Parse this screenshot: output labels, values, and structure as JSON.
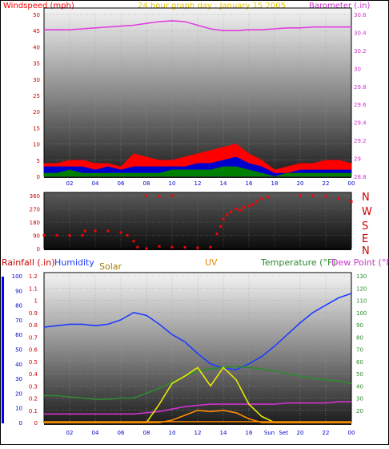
{
  "colors": {
    "windspeed": "#ff0000",
    "wind_avg": "#0000cc",
    "wind_low": "#008000",
    "barometer": "#e040e0",
    "direction": "#ff0000",
    "humidity": "#1e3cff",
    "temperature": "#2e8b2e",
    "dewpoint": "#cc33cc",
    "solar": "#e8e800",
    "uv": "#ff8c00",
    "rainfall": "#0000ff",
    "dew_pink": "#ff3399",
    "title": "#e8c800",
    "frame": "#000000"
  },
  "chart_data": [
    {
      "type": "line",
      "title": "24 hour graph day : January 15 2005",
      "ylabel": "Windspeed (mph)",
      "y2label": "Barometer (.in)",
      "ylim": [
        0,
        50
      ],
      "y2lim": [
        28.8,
        30.6
      ],
      "yticks": [
        "0",
        "5",
        "10",
        "15",
        "20",
        "25",
        "30",
        "35",
        "40",
        "45",
        "50"
      ],
      "y2ticks": [
        "28.8",
        "29",
        "29.2",
        "29.4",
        "29.6",
        "29.8",
        "30",
        "30.2",
        "30.4",
        "30.6"
      ],
      "xticks": [
        "02",
        "04",
        "06",
        "08",
        "10",
        "12",
        "14",
        "16",
        "18",
        "20",
        "22",
        "00"
      ],
      "x": [
        0,
        1,
        2,
        3,
        4,
        5,
        6,
        7,
        8,
        9,
        10,
        11,
        12,
        13,
        14,
        15,
        16,
        17,
        18,
        19,
        20,
        21,
        22,
        23,
        24
      ],
      "series": [
        {
          "key": "barometer",
          "axis": "right",
          "values": [
            30.43,
            30.43,
            30.43,
            30.44,
            30.45,
            30.46,
            30.47,
            30.48,
            30.5,
            30.52,
            30.53,
            30.52,
            30.48,
            30.44,
            30.42,
            30.42,
            30.43,
            30.43,
            30.44,
            30.45,
            30.45,
            30.46,
            30.46,
            30.46,
            30.46
          ]
        },
        {
          "key": "wind_high",
          "axis": "left",
          "values": [
            4,
            4,
            5,
            5,
            4,
            4,
            3,
            7,
            6,
            5,
            5,
            6,
            7,
            8,
            9,
            10,
            7,
            5,
            2,
            3,
            4,
            4,
            5,
            5,
            4
          ]
        },
        {
          "key": "wind_avg",
          "axis": "left",
          "values": [
            3,
            3,
            3,
            3,
            2,
            3,
            2,
            3,
            3,
            3,
            3,
            3,
            4,
            4,
            5,
            6,
            4,
            3,
            1,
            1,
            2,
            2,
            2,
            2,
            2
          ]
        },
        {
          "key": "wind_low",
          "axis": "left",
          "values": [
            1,
            1,
            2,
            1,
            1,
            1,
            1,
            1,
            1,
            1,
            2,
            2,
            2,
            2,
            3,
            3,
            2,
            1,
            0,
            1,
            1,
            1,
            1,
            1,
            1
          ]
        }
      ]
    },
    {
      "type": "scatter",
      "yticks": [
        "0",
        "90",
        "180",
        "270",
        "360"
      ],
      "compass": [
        "N",
        "W",
        "S",
        "E",
        "N"
      ],
      "ylim": [
        0,
        360
      ],
      "xticks": [
        "02",
        "04",
        "06",
        "08",
        "10",
        "12",
        "14",
        "16",
        "18",
        "20",
        "22",
        "00"
      ],
      "points": [
        [
          0,
          90
        ],
        [
          1,
          90
        ],
        [
          2,
          90
        ],
        [
          3,
          90
        ],
        [
          3.2,
          120
        ],
        [
          4,
          120
        ],
        [
          5,
          120
        ],
        [
          6,
          110
        ],
        [
          6.5,
          90
        ],
        [
          7,
          50
        ],
        [
          7.3,
          10
        ],
        [
          8,
          0
        ],
        [
          9,
          15
        ],
        [
          10,
          10
        ],
        [
          11,
          8
        ],
        [
          12,
          5
        ],
        [
          13,
          10
        ],
        [
          13.5,
          100
        ],
        [
          13.8,
          150
        ],
        [
          14,
          200
        ],
        [
          14.3,
          230
        ],
        [
          14.6,
          250
        ],
        [
          15,
          270
        ],
        [
          15.3,
          260
        ],
        [
          15.6,
          280
        ],
        [
          16,
          290
        ],
        [
          16.3,
          300
        ],
        [
          16.6,
          320
        ],
        [
          17,
          340
        ],
        [
          17.5,
          350
        ],
        [
          8,
          360
        ],
        [
          9,
          355
        ],
        [
          10,
          360
        ],
        [
          20,
          360
        ],
        [
          21,
          360
        ],
        [
          22,
          355
        ],
        [
          23,
          340
        ],
        [
          24,
          320
        ]
      ]
    },
    {
      "type": "line",
      "ylabel_left_1": "Rainfall (.in)",
      "ylabel_left_2": "Humidity",
      "label_solar": "Solar",
      "label_uv": "UV",
      "y2label_1": "Temperature (°F)",
      "y2label_2": "Dew Point (°F)",
      "ylim_humidity": [
        0,
        100
      ],
      "ylim_rain": [
        0,
        1.2
      ],
      "y2lim": [
        10,
        130
      ],
      "humidity_ticks": [
        "0",
        "10",
        "20",
        "30",
        "40",
        "50",
        "60",
        "70",
        "80",
        "90",
        "100"
      ],
      "rain_ticks": [
        "0",
        "0.1",
        "0.2",
        "0.3",
        "0.4",
        "0.5",
        "0.6",
        "0.7",
        "0.8",
        "0.9",
        "1",
        "1.1",
        "1.2"
      ],
      "temp_ticks": [
        "20",
        "30",
        "40",
        "50",
        "60",
        "70",
        "80",
        "90",
        "100",
        "110",
        "120",
        "130"
      ],
      "xticks": [
        "02",
        "04",
        "06",
        "08",
        "10",
        "12",
        "14",
        "16",
        "Sun",
        "Set",
        "20",
        "22",
        "00"
      ],
      "x": [
        0,
        1,
        2,
        3,
        4,
        5,
        6,
        7,
        8,
        9,
        10,
        11,
        12,
        13,
        14,
        15,
        16,
        17,
        18,
        19,
        20,
        21,
        22,
        23,
        24
      ],
      "series": [
        {
          "key": "humidity",
          "values": [
            65,
            66,
            67,
            67,
            66,
            67,
            70,
            75,
            73,
            67,
            60,
            55,
            47,
            40,
            37,
            36,
            40,
            45,
            52,
            60,
            68,
            75,
            80,
            85,
            88
          ]
        },
        {
          "key": "temperature",
          "values": [
            32,
            32,
            31,
            30,
            29,
            29,
            30,
            30,
            34,
            38,
            43,
            48,
            52,
            54,
            55,
            56,
            55,
            54,
            52,
            50,
            48,
            46,
            45,
            44,
            42
          ]
        },
        {
          "key": "dewpoint",
          "values": [
            17,
            17,
            17,
            17,
            17,
            17,
            17,
            17,
            18,
            19,
            21,
            23,
            24,
            25,
            25,
            25,
            25,
            25,
            25,
            26,
            26,
            26,
            26,
            27,
            27
          ]
        },
        {
          "key": "solar",
          "values": [
            0,
            0,
            0,
            0,
            0,
            0,
            0,
            0,
            0,
            0.15,
            0.32,
            0.38,
            0.45,
            0.3,
            0.45,
            0.35,
            0.15,
            0.05,
            0,
            0,
            0,
            0,
            0,
            0,
            0
          ]
        },
        {
          "key": "uv",
          "values": [
            0,
            0,
            0,
            0,
            0,
            0,
            0,
            0,
            0,
            0,
            0.02,
            0.06,
            0.1,
            0.09,
            0.1,
            0.08,
            0.03,
            0,
            0,
            0,
            0,
            0,
            0,
            0,
            0
          ]
        }
      ]
    }
  ]
}
